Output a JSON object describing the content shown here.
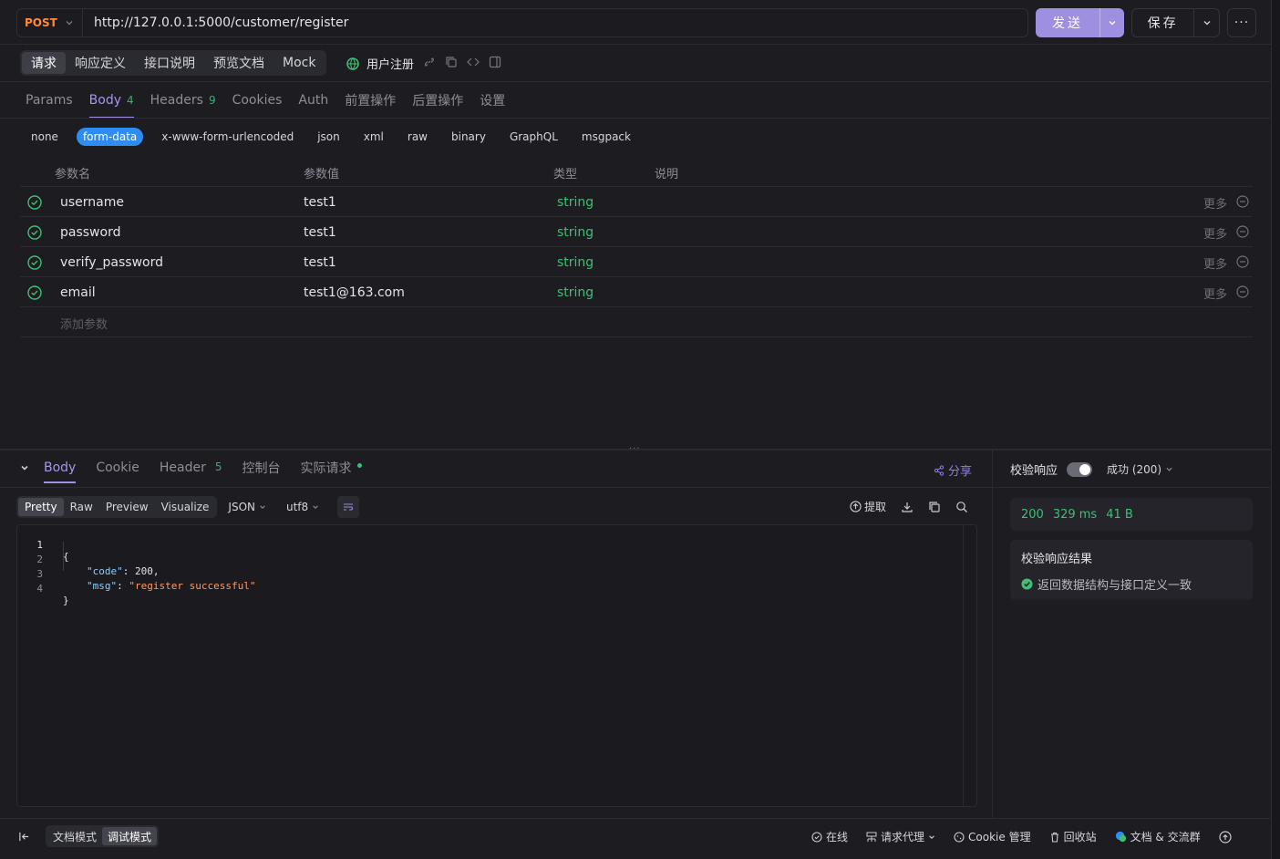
{
  "request": {
    "method": "POST",
    "url": "http://127.0.0.1:5000/customer/register",
    "send_label": "发送",
    "save_label": "保存",
    "more_label": "···"
  },
  "subtabs": [
    "请求",
    "响应定义",
    "接口说明",
    "预览文档",
    "Mock"
  ],
  "api_name": "用户注册",
  "request_tabs": [
    {
      "label": "Params",
      "count": ""
    },
    {
      "label": "Body",
      "count": "4"
    },
    {
      "label": "Headers",
      "count": "9"
    },
    {
      "label": "Cookies",
      "count": ""
    },
    {
      "label": "Auth",
      "count": ""
    },
    {
      "label": "前置操作",
      "count": ""
    },
    {
      "label": "后置操作",
      "count": ""
    },
    {
      "label": "设置",
      "count": ""
    }
  ],
  "body_types": [
    "none",
    "form-data",
    "x-www-form-urlencoded",
    "json",
    "xml",
    "raw",
    "binary",
    "GraphQL",
    "msgpack"
  ],
  "table_headers": {
    "name": "参数名",
    "value": "参数值",
    "type": "类型",
    "desc": "说明"
  },
  "params": [
    {
      "name": "username",
      "value": "test1",
      "type": "string",
      "more": "更多"
    },
    {
      "name": "password",
      "value": "test1",
      "type": "string",
      "more": "更多"
    },
    {
      "name": "verify_password",
      "value": "test1",
      "type": "string",
      "more": "更多"
    },
    {
      "name": "email",
      "value": "test1@163.com",
      "type": "string",
      "more": "更多"
    }
  ],
  "add_param_placeholder": "添加参数",
  "response_tabs": {
    "body": "Body",
    "cookie": "Cookie",
    "header": "Header",
    "header_count": "5",
    "console": "控制台",
    "actual": "实际请求"
  },
  "share_label": "分享",
  "format_tabs": [
    "Pretty",
    "Raw",
    "Preview",
    "Visualize"
  ],
  "format_select": "JSON",
  "encoding_select": "utf8",
  "extract_label": "提取",
  "code_lines": [
    {
      "no": "1",
      "text": "{"
    },
    {
      "no": "2",
      "key": "\"code\"",
      "sep": ": ",
      "val": "200",
      "tail": ","
    },
    {
      "no": "3",
      "key": "\"msg\"",
      "sep": ": ",
      "val": "\"register successful\"",
      "tail": ""
    },
    {
      "no": "4",
      "text": "}"
    }
  ],
  "validation": {
    "label": "校验响应",
    "status": "成功 (200)",
    "code": "200",
    "time": "329 ms",
    "size": "41 B",
    "result_title": "校验响应结果",
    "result_text": "返回数据结构与接口定义一致"
  },
  "bottom": {
    "doc_mode": "文档模式",
    "debug_mode": "调试模式",
    "online": "在线",
    "proxy": "请求代理",
    "cookie_mgmt": "Cookie 管理",
    "recycle": "回收站",
    "docs": "文档 & 交流群"
  },
  "colors": {
    "accent": "#9f8fe0",
    "success": "#3fbf74",
    "method": "#ff8a3d",
    "form_data": "#2f8cf2"
  }
}
